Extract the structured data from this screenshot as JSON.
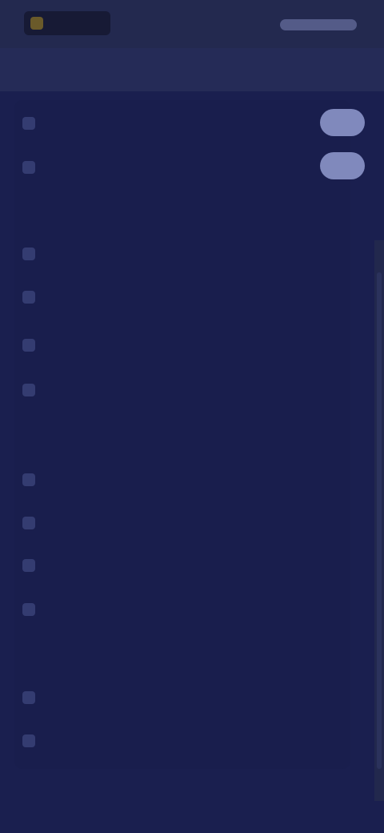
{
  "header": {
    "logo_text": "",
    "action_text": ""
  },
  "tabs": [
    {
      "label": ""
    },
    {
      "label": ""
    }
  ],
  "menu": {
    "items": [
      {
        "label": ""
      },
      {
        "label": ""
      },
      {
        "label": ""
      },
      {
        "label": ""
      },
      {
        "label": ""
      },
      {
        "label": ""
      },
      {
        "label": ""
      },
      {
        "label": ""
      },
      {
        "label": ""
      },
      {
        "label": ""
      },
      {
        "label": ""
      },
      {
        "label": ""
      },
      {
        "label": ""
      }
    ],
    "sections": [
      {
        "label": ""
      },
      {
        "label": ""
      },
      {
        "label": ""
      }
    ]
  }
}
